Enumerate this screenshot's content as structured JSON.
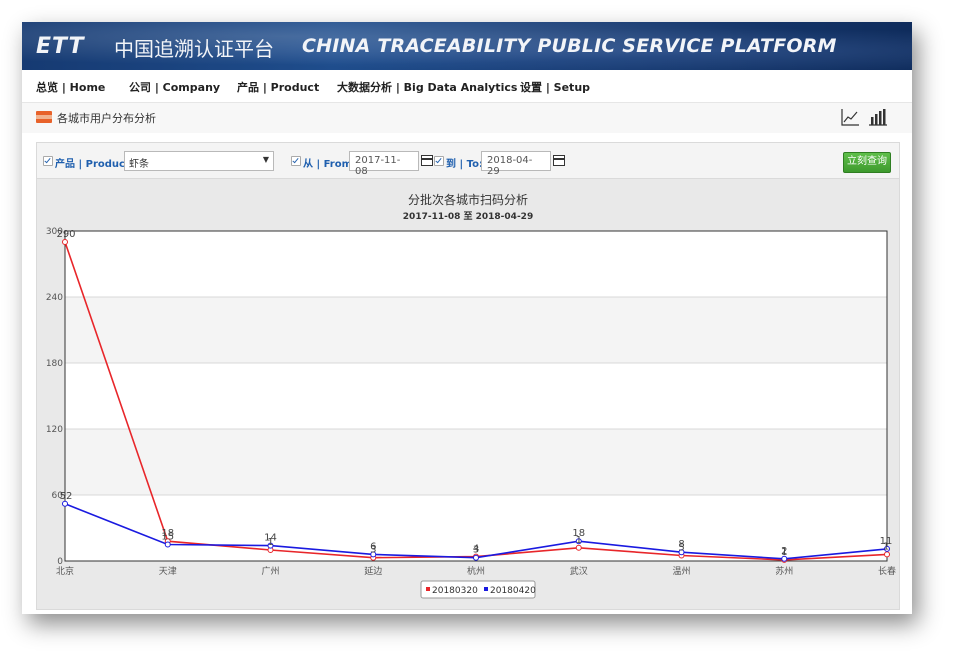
{
  "header": {
    "logo_text": "ETT",
    "site_title_cn": "中国追溯认证平台",
    "site_title_en": "CHINA TRACEABILITY PUBLIC SERVICE PLATFORM"
  },
  "nav": {
    "items": [
      {
        "label": "总览 | Home"
      },
      {
        "label": "公司 | Company"
      },
      {
        "label": "产品 | Product"
      },
      {
        "label": "大数据分析 | Big Data Analytics"
      },
      {
        "label": "设置 | Setup"
      }
    ]
  },
  "page": {
    "title": "各城市用户分布分析"
  },
  "filters": {
    "product_label": "产品 | Product:",
    "product_value": "虾条",
    "from_label": "从 | From:",
    "from_value": "2017-11-08",
    "to_label": "到 | To:",
    "to_value": "2018-04-29",
    "query_button": "立刻查询"
  },
  "colors": {
    "series1": "#e8262a",
    "series2": "#1a1ae0",
    "accent": "#1f5fae",
    "button": "#46a335"
  },
  "chart_data": {
    "type": "line",
    "title": "分批次各城市扫码分析",
    "subtitle": "2017-11-08 至 2018-04-29",
    "categories": [
      "北京",
      "天津",
      "广州",
      "延边",
      "杭州",
      "武汉",
      "温州",
      "苏州",
      "长春"
    ],
    "series": [
      {
        "name": "20180320",
        "values": [
          290,
          18,
          10,
          3,
          4,
          12,
          5,
          1,
          6
        ]
      },
      {
        "name": "20180420",
        "values": [
          52,
          15,
          14,
          6,
          3,
          18,
          8,
          2,
          11
        ]
      }
    ],
    "data_labels": [
      [
        "290",
        "18",
        "1",
        "3",
        "4",
        "1",
        "5",
        "1",
        "1"
      ],
      [
        "52",
        "15",
        "14",
        "6",
        "3",
        "18",
        "8",
        "2",
        "11"
      ]
    ],
    "ylim": [
      0,
      300
    ],
    "yticks": [
      0,
      60,
      120,
      180,
      240,
      300
    ],
    "ytick_labels": [
      "0",
      "60",
      "120",
      "180",
      "240",
      "300"
    ],
    "grid": true,
    "legend_position": "bottom-center"
  }
}
